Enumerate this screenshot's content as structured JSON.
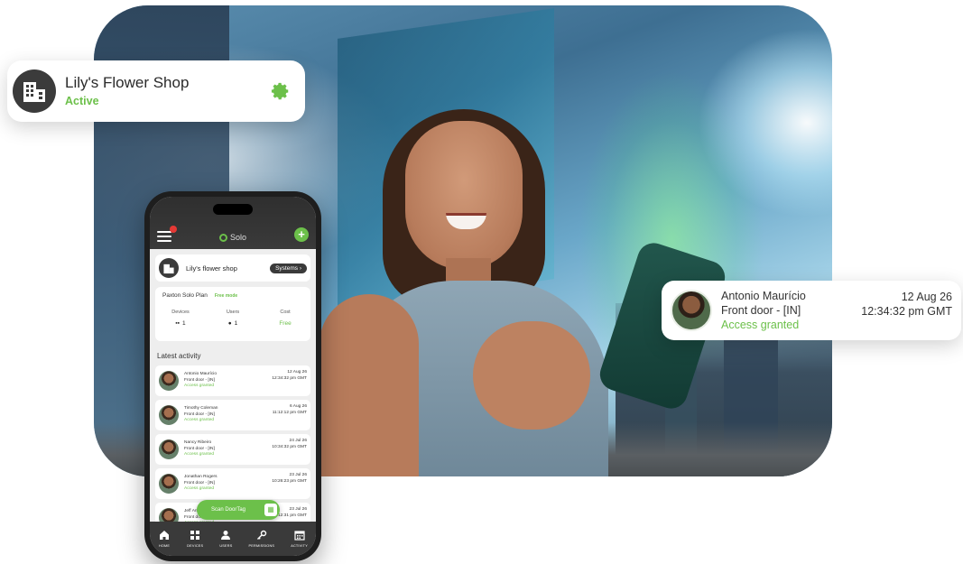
{
  "shop_card": {
    "name": "Lily's Flower Shop",
    "status": "Active"
  },
  "activity_card": {
    "name": "Antonio Maurício",
    "door": "Front door - [IN]",
    "status": "Access granted",
    "date": "12 Aug 26",
    "time": "12:34:32 pm GMT"
  },
  "phone": {
    "app_name": "Solo",
    "shop_name": "Lily's flower shop",
    "systems_label": "Systems",
    "plan": {
      "name": "Paxton Solo Plan",
      "mode": "Free mode",
      "stats": [
        {
          "label": "Devices",
          "value": "1"
        },
        {
          "label": "Users",
          "value": "1"
        },
        {
          "label": "Cost",
          "value": "Free"
        }
      ]
    },
    "latest_title": "Latest activity",
    "activity": [
      {
        "name": "Antonio Maurício",
        "door": "Front door - [IN]",
        "status": "Access granted",
        "date": "12 Aug 26",
        "time": "12:34:32 pm GMT"
      },
      {
        "name": "Timothy Coleman",
        "door": "Front door - [IN]",
        "status": "Access granted",
        "date": "6 Aug 26",
        "time": "11:12:12 pm GMT"
      },
      {
        "name": "Nancy Ribeiro",
        "door": "Front door - [IN]",
        "status": "Access granted",
        "date": "24 Jul 26",
        "time": "10:34:32 pm GMT"
      },
      {
        "name": "Jonathan Rogers",
        "door": "Front door - [IN]",
        "status": "Access granted",
        "date": "23 Jul 26",
        "time": "10:26:23 pm GMT"
      },
      {
        "name": "Jeff Andrews",
        "door": "Front door - [IN]",
        "status": "Access granted",
        "date": "23 Jul 26",
        "time": "10:12:31 pm GMT"
      }
    ],
    "scan_label": "Scan DoorTag",
    "nav": [
      "HOME",
      "DEVICES",
      "USERS",
      "PERMISSIONS",
      "ACTIVITY"
    ]
  },
  "colors": {
    "accent": "#6cc04a",
    "dark": "#3a3a3a"
  }
}
